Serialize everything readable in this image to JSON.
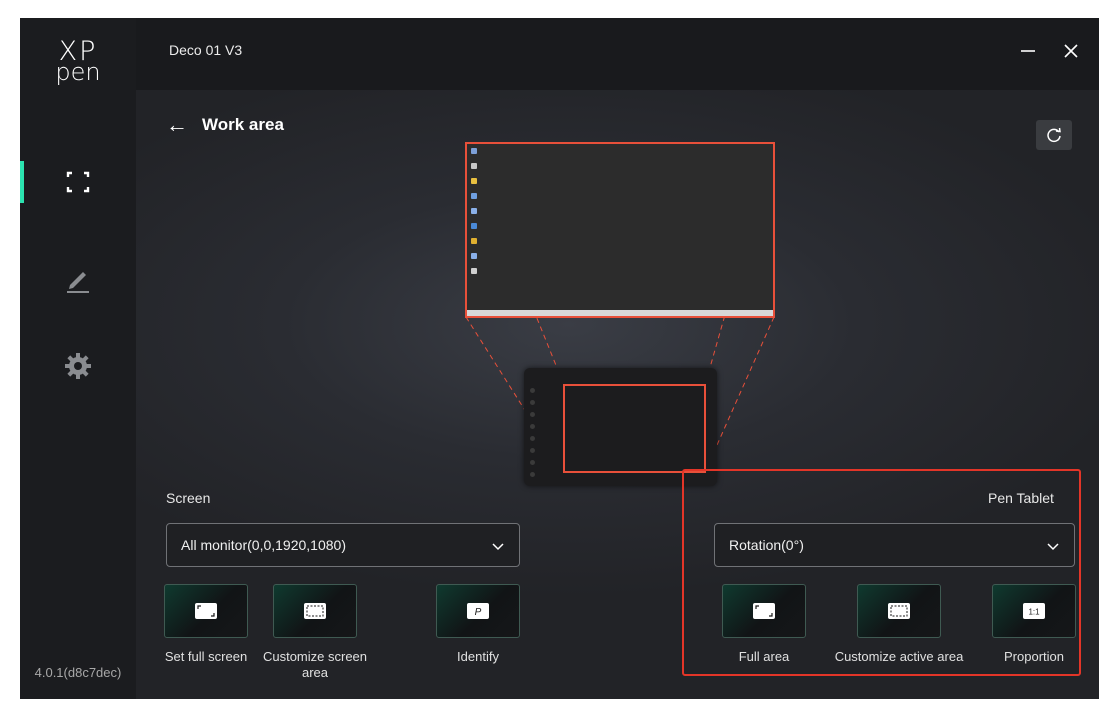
{
  "app": {
    "logo_line1": "XP",
    "logo_line2": "pen",
    "version": "4.0.1(d8c7dec)",
    "accent_color": "#2ce3b0",
    "highlight_color": "#e33528",
    "area_color": "#e8503a"
  },
  "sidebar": {
    "items": [
      {
        "name": "work-area",
        "icon": "work-area-icon",
        "active": true
      },
      {
        "name": "pen",
        "icon": "pen-icon",
        "active": false
      },
      {
        "name": "settings",
        "icon": "gear-icon",
        "active": false
      }
    ]
  },
  "titlebar": {
    "device_name": "Deco 01 V3",
    "minimize_icon": "minimize-icon",
    "close_icon": "close-icon"
  },
  "header": {
    "back_icon": "←",
    "title": "Work area",
    "refresh_icon": "refresh-icon"
  },
  "screen": {
    "label": "Screen",
    "monitor_selected": "All monitor(0,0,1920,1080)",
    "buttons": [
      {
        "label": "Set full screen",
        "icon": "full-screen-icon"
      },
      {
        "label": "Customize screen area",
        "icon": "customize-area-icon"
      },
      {
        "label": "Identify",
        "icon": "identify-icon",
        "glyph": "P"
      }
    ]
  },
  "pen_tablet": {
    "label": "Pen Tablet",
    "rotation_selected": "Rotation(0°)",
    "buttons": [
      {
        "label": "Full area",
        "icon": "full-area-icon"
      },
      {
        "label": "Customize active area",
        "icon": "customize-active-area-icon"
      },
      {
        "label": "Proportion",
        "icon": "proportion-icon",
        "glyph": "1:1"
      }
    ]
  }
}
